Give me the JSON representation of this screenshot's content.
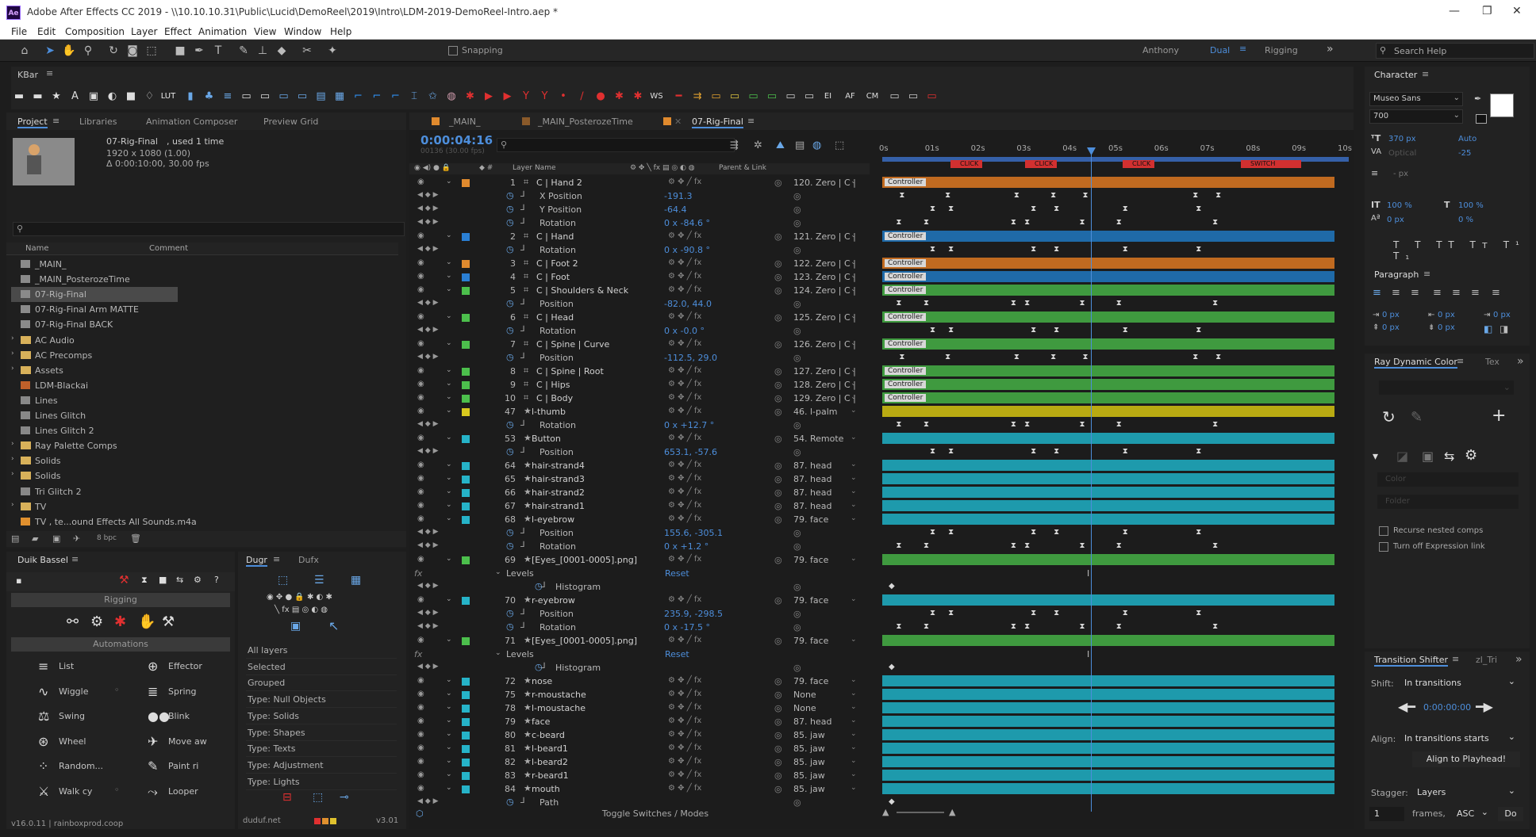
{
  "window": {
    "title": "Adobe After Effects CC 2019 - \\\\10.10.10.31\\Public\\Lucid\\DemoReel\\2019\\Intro\\LDM-2019-DemoReel-Intro.aep *",
    "app_icon": "Ae"
  },
  "menu": [
    "File",
    "Edit",
    "Composition",
    "Layer",
    "Effect",
    "Animation",
    "View",
    "Window",
    "Help"
  ],
  "toolbar": {
    "snapping": "Snapping",
    "workspaces": [
      "Anthony",
      "Dual",
      "Rigging"
    ],
    "search": "Search Help"
  },
  "kbar": {
    "title": "KBar",
    "labels": [
      "LUT",
      "WS",
      "EI",
      "AF",
      "CM"
    ]
  },
  "project": {
    "tabs": [
      "Project",
      "Libraries",
      "Animation Composer",
      "Preview Grid"
    ],
    "comp_name": "07-Rig-Final",
    "comp_used": ", used 1 time",
    "comp_info": [
      "1920 x 1080 (1.00)",
      "Δ 0:00:10:00, 30.00 fps"
    ],
    "col_name": "Name",
    "col_comment": "Comment",
    "items": [
      "_MAIN_",
      "_MAIN_PosterozeTime",
      "07-Rig-Final",
      "07-Rig-Final Arm MATTE",
      "07-Rig-Final BACK",
      "AC Audio",
      "AC Precomps",
      "Assets",
      "LDM-Blackai",
      "Lines",
      "Lines Glitch",
      "Lines Glitch 2",
      "Ray Palette Comps",
      "Solids",
      "Solids",
      "Tri Glitch 2",
      "TV",
      "TV , te...ound Effects All Sounds.m4a"
    ],
    "bpc": "8 bpc"
  },
  "duik": {
    "title": "Duik Bassel",
    "rigging": "Rigging",
    "automations": "Automations",
    "items": [
      "List",
      "Effector",
      "Wiggle",
      "Spring",
      "Swing",
      "Blink",
      "Wheel",
      "Move aw",
      "Random...",
      "Paint ri",
      "Walk cy",
      "Looper"
    ],
    "version": "v16.0.11 | rainboxprod.coop"
  },
  "dugr": {
    "tabs": [
      "Dugr",
      "Dufx"
    ],
    "items": [
      "All layers",
      "Selected",
      "Grouped",
      "Type: Null Objects",
      "Type: Solids",
      "Type: Shapes",
      "Type: Texts",
      "Type: Adjustment",
      "Type: Lights"
    ],
    "footer": "duduf.net",
    "version": "v3.01"
  },
  "timeline": {
    "tabs": [
      "_MAIN_",
      "_MAIN_PosterozeTime",
      "07-Rig-Final"
    ],
    "timecode": "0:00:04:16",
    "frames": "00136 (30.00 fps)",
    "col_layer": "Layer Name",
    "col_parent": "Parent & Link",
    "ruler": [
      "0s",
      "01s",
      "02s",
      "03s",
      "04s",
      "05s",
      "06s",
      "07s",
      "08s",
      "09s",
      "10s"
    ],
    "markers": [
      "CLICK",
      "CLICK",
      "CLICK",
      "SWITCH"
    ],
    "toggle": "Toggle Switches / Modes",
    "rows": [
      {
        "n": "1",
        "name": "C | Hand 2",
        "par": "120. Zero | C |",
        "kind": "layer",
        "color": "#e08a2e",
        "bar": "#c06a20",
        "ctl": "Controller"
      },
      {
        "name": "X Position",
        "val": "-191.3",
        "kind": "prop"
      },
      {
        "name": "Y Position",
        "val": "-64.4",
        "kind": "prop"
      },
      {
        "name": "Rotation",
        "val": "0 x -84.6 °",
        "kind": "prop"
      },
      {
        "n": "2",
        "name": "C | Hand",
        "par": "121. Zero | C |",
        "kind": "layer",
        "color": "#2a7fd4",
        "bar": "#1f6aa8",
        "ctl": "Controller"
      },
      {
        "name": "Rotation",
        "val": "0 x -90.8 °",
        "kind": "prop"
      },
      {
        "n": "3",
        "name": "C | Foot 2",
        "par": "122. Zero | C |",
        "kind": "layer",
        "color": "#e08a2e",
        "bar": "#c06a20",
        "ctl": "Controller"
      },
      {
        "n": "4",
        "name": "C | Foot",
        "par": "123. Zero | C |",
        "kind": "layer",
        "color": "#2a7fd4",
        "bar": "#1f6aa8",
        "ctl": "Controller"
      },
      {
        "n": "5",
        "name": "C | Shoulders & Neck",
        "par": "124. Zero | C |",
        "kind": "layer",
        "color": "#4cbf4c",
        "bar": "#3f9a3f",
        "ctl": "Controller"
      },
      {
        "name": "Position",
        "val": "-82.0, 44.0",
        "kind": "prop"
      },
      {
        "n": "6",
        "name": "C | Head",
        "par": "125. Zero | C |",
        "kind": "layer",
        "color": "#4cbf4c",
        "bar": "#3f9a3f",
        "ctl": "Controller"
      },
      {
        "name": "Rotation",
        "val": "0 x -0.0 °",
        "kind": "prop"
      },
      {
        "n": "7",
        "name": "C | Spine | Curve",
        "par": "126. Zero | C |",
        "kind": "layer",
        "color": "#4cbf4c",
        "bar": "#3f9a3f",
        "ctl": "Controller"
      },
      {
        "name": "Position",
        "val": "-112.5, 29.0",
        "kind": "prop"
      },
      {
        "n": "8",
        "name": "C | Spine | Root",
        "par": "127. Zero | C |",
        "kind": "layer",
        "color": "#4cbf4c",
        "bar": "#3f9a3f",
        "ctl": "Controller"
      },
      {
        "n": "9",
        "name": "C | Hips",
        "par": "128. Zero | C |",
        "kind": "layer",
        "color": "#4cbf4c",
        "bar": "#3f9a3f",
        "ctl": "Controller"
      },
      {
        "n": "10",
        "name": "C | Body",
        "par": "129. Zero | C |",
        "kind": "layer",
        "color": "#4cbf4c",
        "bar": "#3f9a3f",
        "ctl": "Controller"
      },
      {
        "n": "47",
        "name": "l-thumb",
        "par": "46. l-palm",
        "kind": "layer",
        "color": "#d8c81e",
        "bar": "#b9aa12"
      },
      {
        "name": "Rotation",
        "val": "0 x +12.7 °",
        "kind": "prop"
      },
      {
        "n": "53",
        "name": "Button",
        "par": "54. Remote",
        "kind": "layer",
        "color": "#26b3c8",
        "bar": "#1e9aac"
      },
      {
        "name": "Position",
        "val": "653.1, -57.6",
        "kind": "prop"
      },
      {
        "n": "64",
        "name": "hair-strand4",
        "par": "87. head",
        "kind": "layer",
        "color": "#26b3c8",
        "bar": "#1e9aac"
      },
      {
        "n": "65",
        "name": "hair-strand3",
        "par": "87. head",
        "kind": "layer",
        "color": "#26b3c8",
        "bar": "#1e9aac"
      },
      {
        "n": "66",
        "name": "hair-strand2",
        "par": "87. head",
        "kind": "layer",
        "color": "#26b3c8",
        "bar": "#1e9aac"
      },
      {
        "n": "67",
        "name": "hair-strand1",
        "par": "87. head",
        "kind": "layer",
        "color": "#26b3c8",
        "bar": "#1e9aac"
      },
      {
        "n": "68",
        "name": "l-eyebrow",
        "par": "79. face",
        "kind": "layer",
        "color": "#26b3c8",
        "bar": "#1e9aac"
      },
      {
        "name": "Position",
        "val": "155.6, -305.1",
        "kind": "prop"
      },
      {
        "name": "Rotation",
        "val": "0 x +1.2 °",
        "kind": "prop"
      },
      {
        "n": "69",
        "name": "[Eyes_[0001-0005].png]",
        "par": "79. face",
        "kind": "layer",
        "color": "#4cbf4c",
        "bar": "#3f9a3f"
      },
      {
        "name": "Levels",
        "val": "Reset",
        "kind": "fx"
      },
      {
        "name": "Histogram",
        "kind": "prop2"
      },
      {
        "n": "70",
        "name": "r-eyebrow",
        "par": "79. face",
        "kind": "layer",
        "color": "#26b3c8",
        "bar": "#1e9aac"
      },
      {
        "name": "Position",
        "val": "235.9, -298.5",
        "kind": "prop"
      },
      {
        "name": "Rotation",
        "val": "0 x -17.5 °",
        "kind": "prop"
      },
      {
        "n": "71",
        "name": "[Eyes_[0001-0005].png]",
        "par": "79. face",
        "kind": "layer",
        "color": "#4cbf4c",
        "bar": "#3f9a3f"
      },
      {
        "name": "Levels",
        "val": "Reset",
        "kind": "fx"
      },
      {
        "name": "Histogram",
        "kind": "prop2"
      },
      {
        "n": "72",
        "name": "nose",
        "par": "79. face",
        "kind": "layer",
        "color": "#26b3c8",
        "bar": "#1e9aac"
      },
      {
        "n": "75",
        "name": "r-moustache",
        "par": "None",
        "kind": "layer",
        "color": "#26b3c8",
        "bar": "#1e9aac"
      },
      {
        "n": "78",
        "name": "l-moustache",
        "par": "None",
        "kind": "layer",
        "color": "#26b3c8",
        "bar": "#1e9aac"
      },
      {
        "n": "79",
        "name": "face",
        "par": "87. head",
        "kind": "layer",
        "color": "#26b3c8",
        "bar": "#1e9aac"
      },
      {
        "n": "80",
        "name": "c-beard",
        "par": "85. jaw",
        "kind": "layer",
        "color": "#26b3c8",
        "bar": "#1e9aac"
      },
      {
        "n": "81",
        "name": "l-beard1",
        "par": "85. jaw",
        "kind": "layer",
        "color": "#26b3c8",
        "bar": "#1e9aac"
      },
      {
        "n": "82",
        "name": "l-beard2",
        "par": "85. jaw",
        "kind": "layer",
        "color": "#26b3c8",
        "bar": "#1e9aac"
      },
      {
        "n": "83",
        "name": "r-beard1",
        "par": "85. jaw",
        "kind": "layer",
        "color": "#26b3c8",
        "bar": "#1e9aac"
      },
      {
        "n": "84",
        "name": "mouth",
        "par": "85. jaw",
        "kind": "layer",
        "color": "#26b3c8",
        "bar": "#1e9aac"
      },
      {
        "name": "Path",
        "kind": "prop"
      }
    ]
  },
  "character": {
    "title": "Character",
    "font": "Museo Sans",
    "weight": "700",
    "size": "370 px",
    "leading": "Auto",
    "tracking_label": "Optical",
    "tracking": "-25",
    "stroke": "- px",
    "vscale": "100 %",
    "hscale": "100 %",
    "baseline": "0 px",
    "tsume": "0 %"
  },
  "paragraph": {
    "title": "Paragraph",
    "indents": [
      "0 px",
      "0 px",
      "0 px",
      "0 px",
      "0 px"
    ]
  },
  "ray": {
    "title": "Ray Dynamic Color",
    "tab2": "Tex",
    "color": "Color",
    "folder": "Folder",
    "opt1": "Recurse nested comps",
    "opt2": "Turn off Expression link"
  },
  "transition": {
    "title": "Transition Shifter",
    "tab2": "zl_Tri",
    "shift_label": "Shift:",
    "shift_value": "In transitions",
    "time": "0:00:00:00",
    "align_label": "Align:",
    "align_value": "In transitions starts",
    "align_btn": "Align to Playhead!",
    "stagger_label": "Stagger:",
    "stagger_value": "Layers",
    "frames_val": "1",
    "frames_label": "frames,",
    "order": "ASC",
    "do_btn": "Do"
  }
}
